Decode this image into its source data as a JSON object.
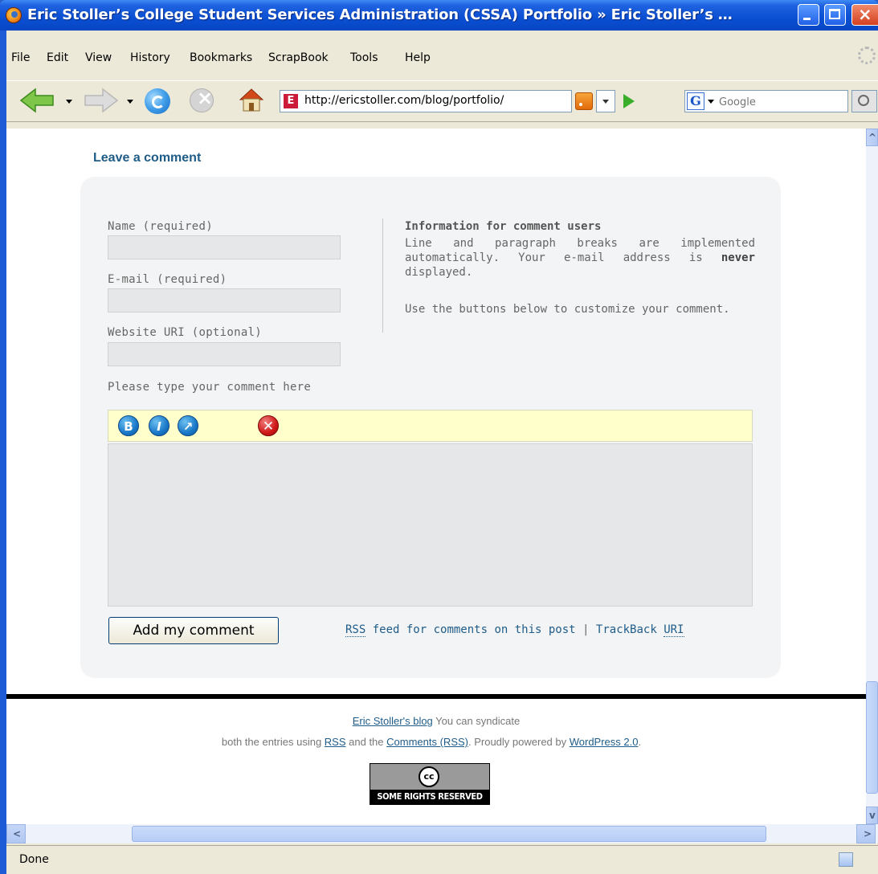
{
  "window": {
    "title": "Eric Stoller’s College Student Services Administration (CSSA) Portfolio » Eric Stoller’s …"
  },
  "menu": [
    "File",
    "Edit",
    "View",
    "History",
    "Bookmarks",
    "ScrapBook",
    "Tools",
    "Help"
  ],
  "navigation": {
    "url": "http://ericstoller.com/blog/portfolio/",
    "favicon_letter": "E",
    "search_placeholder": "Google",
    "search_engine_letter": "G"
  },
  "comment_form": {
    "heading": "Leave a comment",
    "name_label": "Name (required)",
    "email_label": "E-mail (required)",
    "website_label": "Website URI (optional)",
    "comment_label": "Please type your comment here",
    "info_heading": "Information for comment users",
    "info_p1_a": "Line and paragraph breaks are implemented automatically. Your e-mail address is ",
    "info_p1_bold": "never",
    "info_p1_b": " displayed.",
    "info_p2": "Use the buttons below to customize your comment.",
    "toolbar": {
      "bold": "B",
      "italic": "I",
      "link": "↗",
      "close": "✕"
    },
    "submit_label": "Add my comment",
    "rss_abbr": "RSS",
    "rss_link_rest": " feed for comments on this post",
    "separator": "|",
    "trackback_text": "TrackBack ",
    "trackback_abbr": "URI"
  },
  "footer": {
    "blog_link": "Eric Stoller's blog",
    "line1_rest": " You can syndicate",
    "line2_a": "both the entries using ",
    "rss_link": "RSS",
    "line2_b": " and the ",
    "comments_rss_link": "Comments (RSS)",
    "line2_c": ". Proudly powered by ",
    "wordpress_link": "WordPress 2.0",
    "line2_d": ".",
    "cc_logo_text": "cc",
    "cc_text": "SOME RIGHTS RESERVED"
  },
  "status": {
    "text": "Done"
  },
  "colors": {
    "link": "#1f5c88",
    "editor_bar": "#ffffcc",
    "panel": "#f3f4f6"
  }
}
